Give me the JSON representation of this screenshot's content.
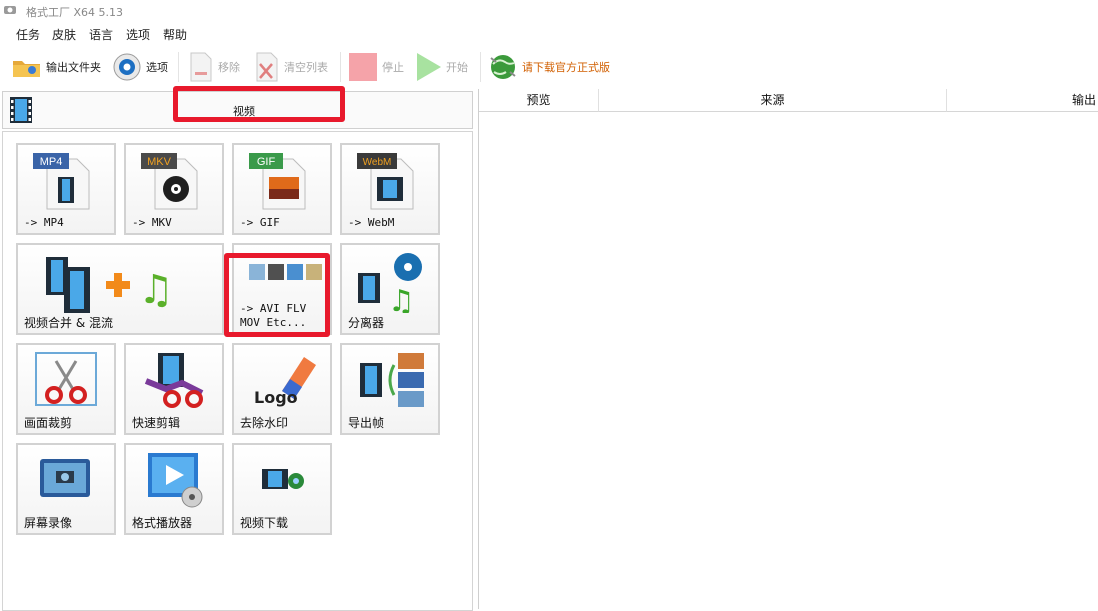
{
  "window": {
    "title": "格式工厂 X64 5.13"
  },
  "menu": [
    "任务",
    "皮肤",
    "语言",
    "选项",
    "帮助"
  ],
  "toolbar": {
    "output_folder": "输出文件夹",
    "options": "选项",
    "remove": "移除",
    "clear_list": "清空列表",
    "stop": "停止",
    "start": "开始",
    "promo": "请下载官方正式版"
  },
  "category": {
    "label": "视频"
  },
  "tools": [
    {
      "label": "-> MP4",
      "badge": "MP4"
    },
    {
      "label": "-> MKV",
      "badge": "MKV"
    },
    {
      "label": "-> GIF",
      "badge": "GIF"
    },
    {
      "label": "-> WebM",
      "badge": "WebM"
    },
    {
      "label": "视频合并 & 混流"
    },
    {
      "label": "-> AVI FLV\nMOV Etc..."
    },
    {
      "label": "分离器"
    },
    {
      "label": "画面裁剪"
    },
    {
      "label": "快速剪辑"
    },
    {
      "label": "去除水印",
      "logo_text": "Logo"
    },
    {
      "label": "导出帧"
    },
    {
      "label": "屏幕录像"
    },
    {
      "label": "格式播放器"
    },
    {
      "label": "视频下载"
    }
  ],
  "table": {
    "columns": [
      "预览",
      "来源",
      "输出"
    ]
  },
  "colors": {
    "highlight": "#e8192c",
    "promo": "#d15f00",
    "disabled": "#aaaaaa"
  }
}
